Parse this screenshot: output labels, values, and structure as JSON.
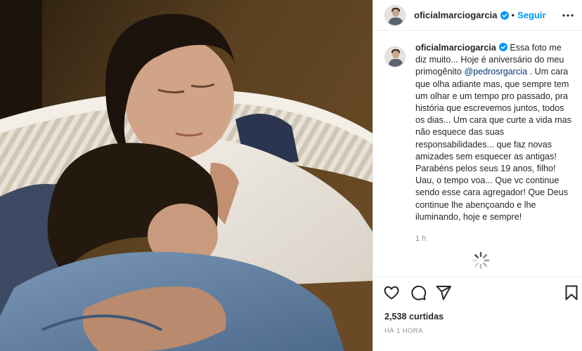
{
  "post": {
    "username": "oficialmarciogarcia",
    "follow_label": "Seguir",
    "separator": "•",
    "caption_text_1": "Essa foto me diz muito... Hoje é aniversário do meu primogênito ",
    "caption_mention": "@pedrosrgarcia",
    "caption_text_2": " . Um cara que olha adiante mas, que sempre tem um olhar e um tempo pro passado, pra história que escrevemos juntos, todos os dias... Um cara que curte a vida mas não esquece das suas responsabilidades... que faz novas amizades sem esquecer as antigas! Parabéns pelos seus 19 anos, filho! Uau, o tempo voa... Que vc continue sendo esse cara agregador! Que Deus continue lhe abençoando e lhe iluminando, hoje e sempre!",
    "caption_age": "1 h",
    "likes": "2,538 curtidas",
    "posted_ago": "HÁ 1 HORA"
  },
  "icons": {
    "verified": "verified-badge-icon",
    "more": "more-options-icon",
    "like": "heart-icon",
    "comment": "comment-icon",
    "share": "paper-plane-icon",
    "save": "bookmark-icon",
    "loading": "loading-spinner-icon"
  },
  "colors": {
    "link_blue": "#0095f6",
    "mention": "#00376b",
    "muted": "#8e8e8e",
    "text": "#262626"
  }
}
